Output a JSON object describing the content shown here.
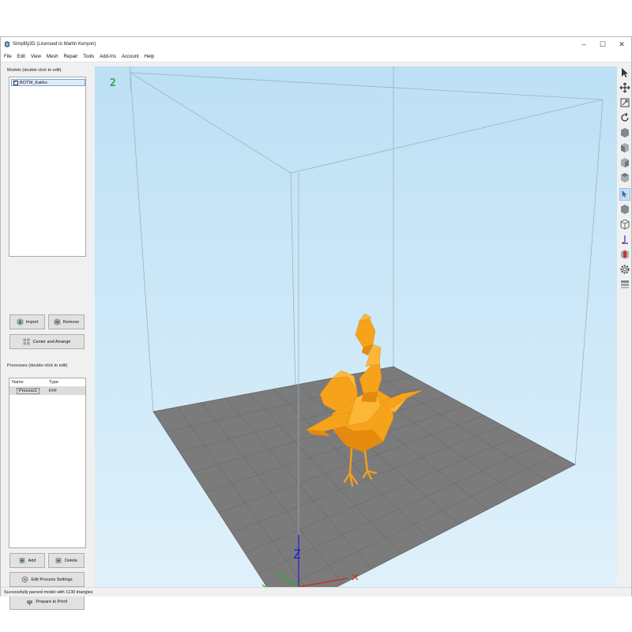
{
  "window": {
    "title": "Simplify3D (Licensed to Martin Kenyon)",
    "controls": {
      "minimize": "–",
      "maximize": "☐",
      "close": "✕"
    }
  },
  "menu": [
    "File",
    "Edit",
    "View",
    "Mesh",
    "Repair",
    "Tools",
    "Add-Ins",
    "Account",
    "Help"
  ],
  "models": {
    "label": "Models (double-click to edit)",
    "items": [
      {
        "name": "BOTW_Kakko",
        "checked": true
      }
    ],
    "import_label": "Import",
    "remove_label": "Remove",
    "center_label": "Center and Arrange"
  },
  "processes": {
    "label": "Processes (double-click to edit)",
    "columns": [
      "Name",
      "Type"
    ],
    "rows": [
      {
        "name": "Process1",
        "type": "FFF"
      }
    ],
    "add_label": "Add",
    "delete_label": "Delete",
    "edit_label": "Edit Process Settings",
    "prepare_label": "Prepare to Print!"
  },
  "viewport": {
    "view_indicator": "2",
    "axis_z": "Z",
    "model_color": "#f7a21b",
    "bed_color": "#7b7b7b",
    "sky_color": "#c5e5f7"
  },
  "toolbar": {
    "tools": [
      "cursor-icon",
      "move-icon",
      "zoom-icon",
      "rotate-icon",
      "view-default-icon",
      "view-front-icon",
      "view-side-icon",
      "view-top-icon",
      "select-icon",
      "cube-solid-icon",
      "cube-wire-icon",
      "axis-icon",
      "cross-section-icon",
      "settings-gear-icon",
      "layer-icon"
    ],
    "active_index": 8
  },
  "status": {
    "text": "Successfully parsed model with 1130 triangles"
  }
}
